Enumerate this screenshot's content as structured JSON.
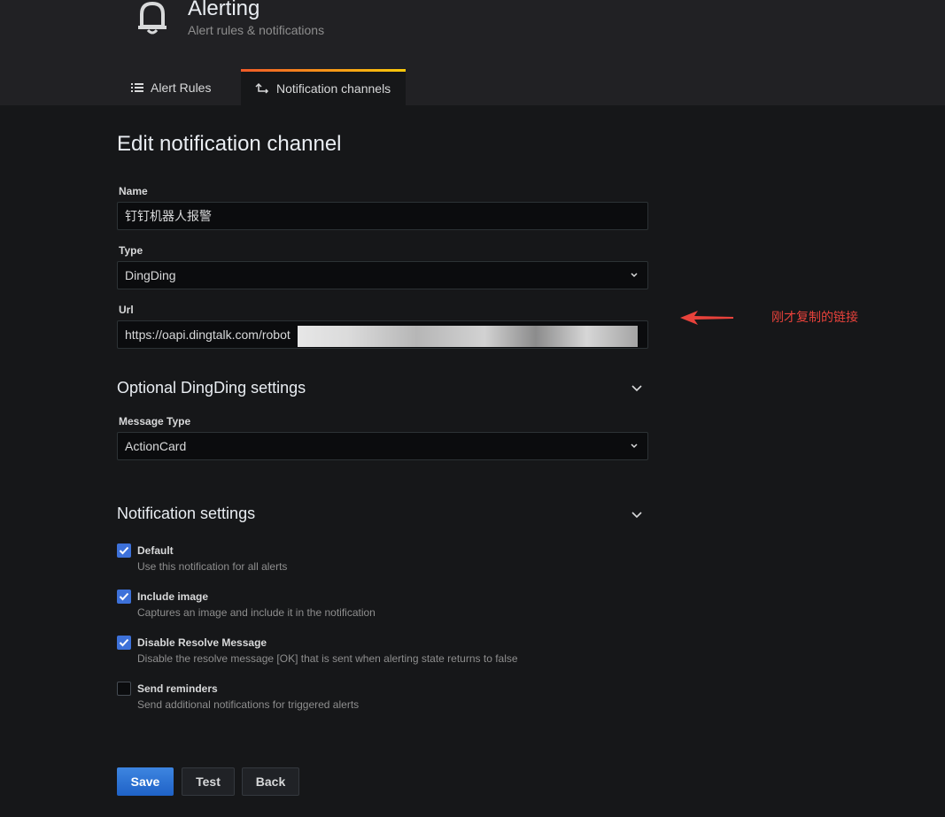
{
  "header": {
    "title": "Alerting",
    "subtitle": "Alert rules & notifications",
    "tabs": [
      {
        "label": "Alert Rules",
        "icon": "list-icon"
      },
      {
        "label": "Notification channels",
        "icon": "channel-icon",
        "active": true
      }
    ]
  },
  "form": {
    "title": "Edit notification channel",
    "name": {
      "label": "Name",
      "value": "钉钉机器人报警"
    },
    "type": {
      "label": "Type",
      "value": "DingDing"
    },
    "url": {
      "label": "Url",
      "value": "https://oapi.dingtalk.com/robot"
    }
  },
  "optional": {
    "title": "Optional DingDing settings",
    "message_type": {
      "label": "Message Type",
      "value": "ActionCard"
    }
  },
  "notification": {
    "title": "Notification settings",
    "options": [
      {
        "label": "Default",
        "desc": "Use this notification for all alerts",
        "checked": true
      },
      {
        "label": "Include image",
        "desc": "Captures an image and include it in the notification",
        "checked": true
      },
      {
        "label": "Disable Resolve Message",
        "desc": "Disable the resolve message [OK] that is sent when alerting state returns to false",
        "checked": true
      },
      {
        "label": "Send reminders",
        "desc": "Send additional notifications for triggered alerts",
        "checked": false
      }
    ]
  },
  "buttons": {
    "save": "Save",
    "test": "Test",
    "back": "Back"
  },
  "annotation": {
    "text": "刚才复制的链接",
    "color": "#e8423b"
  },
  "colors": {
    "accent": "#3d71d9",
    "background": "#161719",
    "header": "#212124"
  }
}
